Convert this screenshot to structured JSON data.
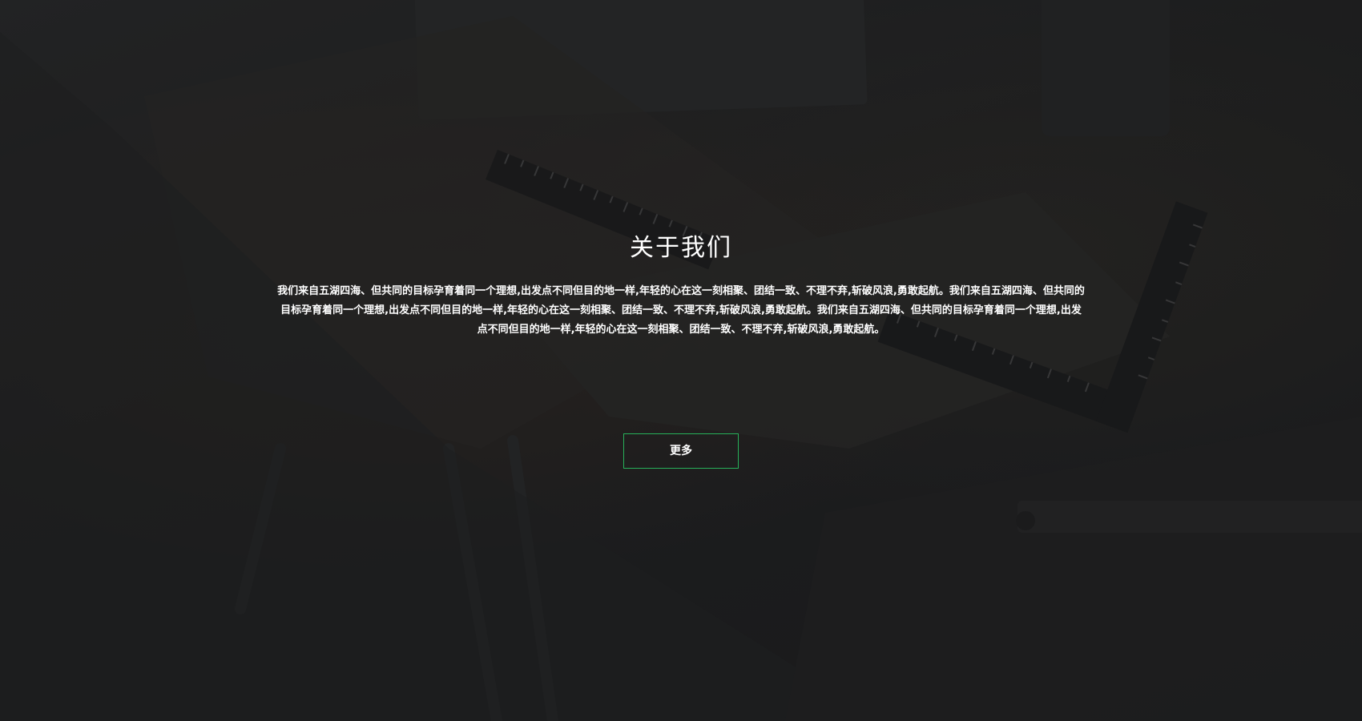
{
  "about": {
    "title": "关于我们",
    "description": "我们来自五湖四海、但共同的目标孕育着同一个理想,出发点不同但目的地一样,年轻的心在这一刻相聚、团结一致、不理不弃,斩破风浪,勇敢起航。我们来自五湖四海、但共同的目标孕育着同一个理想,出发点不同但目的地一样,年轻的心在这一刻相聚、团结一致、不理不弃,斩破风浪,勇敢起航。我们来自五湖四海、但共同的目标孕育着同一个理想,出发点不同但目的地一样,年轻的心在这一刻相聚、团结一致、不理不弃,斩破风浪,勇敢起航。",
    "more_label": "更多"
  },
  "colors": {
    "accent": "#27b15a",
    "text": "#ffffff",
    "background": "#1e1f1f"
  }
}
